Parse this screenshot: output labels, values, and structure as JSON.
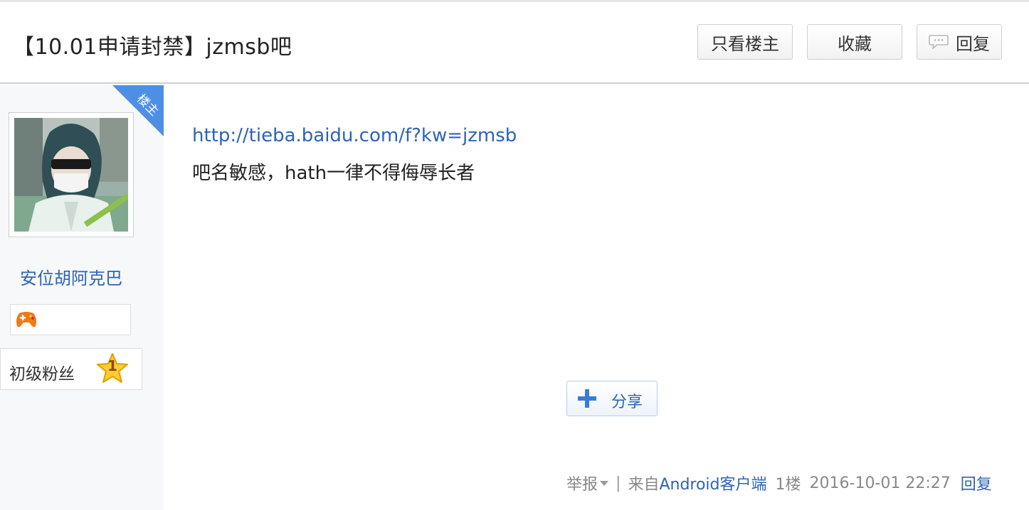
{
  "thread": {
    "title": "【10.01申请封禁】jzmsb吧"
  },
  "header_buttons": {
    "only_op": "只看楼主",
    "favorite": "收藏",
    "reply": "回复"
  },
  "author": {
    "op_badge": "楼主",
    "username": "安位胡阿克巴",
    "level_name": "初级粉丝",
    "level_number": "1"
  },
  "post": {
    "link": "http://tieba.baidu.com/f?kw=jzmsb",
    "text": "吧名敏感，hath一律不得侮辱长者"
  },
  "share": {
    "label": "分享"
  },
  "footer": {
    "report": "举报",
    "separator": "|",
    "from_prefix": "来自",
    "client": "Android客户端",
    "floor": "1楼",
    "timestamp": "2016-10-01 22:27",
    "reply": "回复"
  },
  "colors": {
    "link_blue": "#2d64b3",
    "badge_blue": "#4e8fe6",
    "sidebar_bg": "#f7f8fa"
  }
}
